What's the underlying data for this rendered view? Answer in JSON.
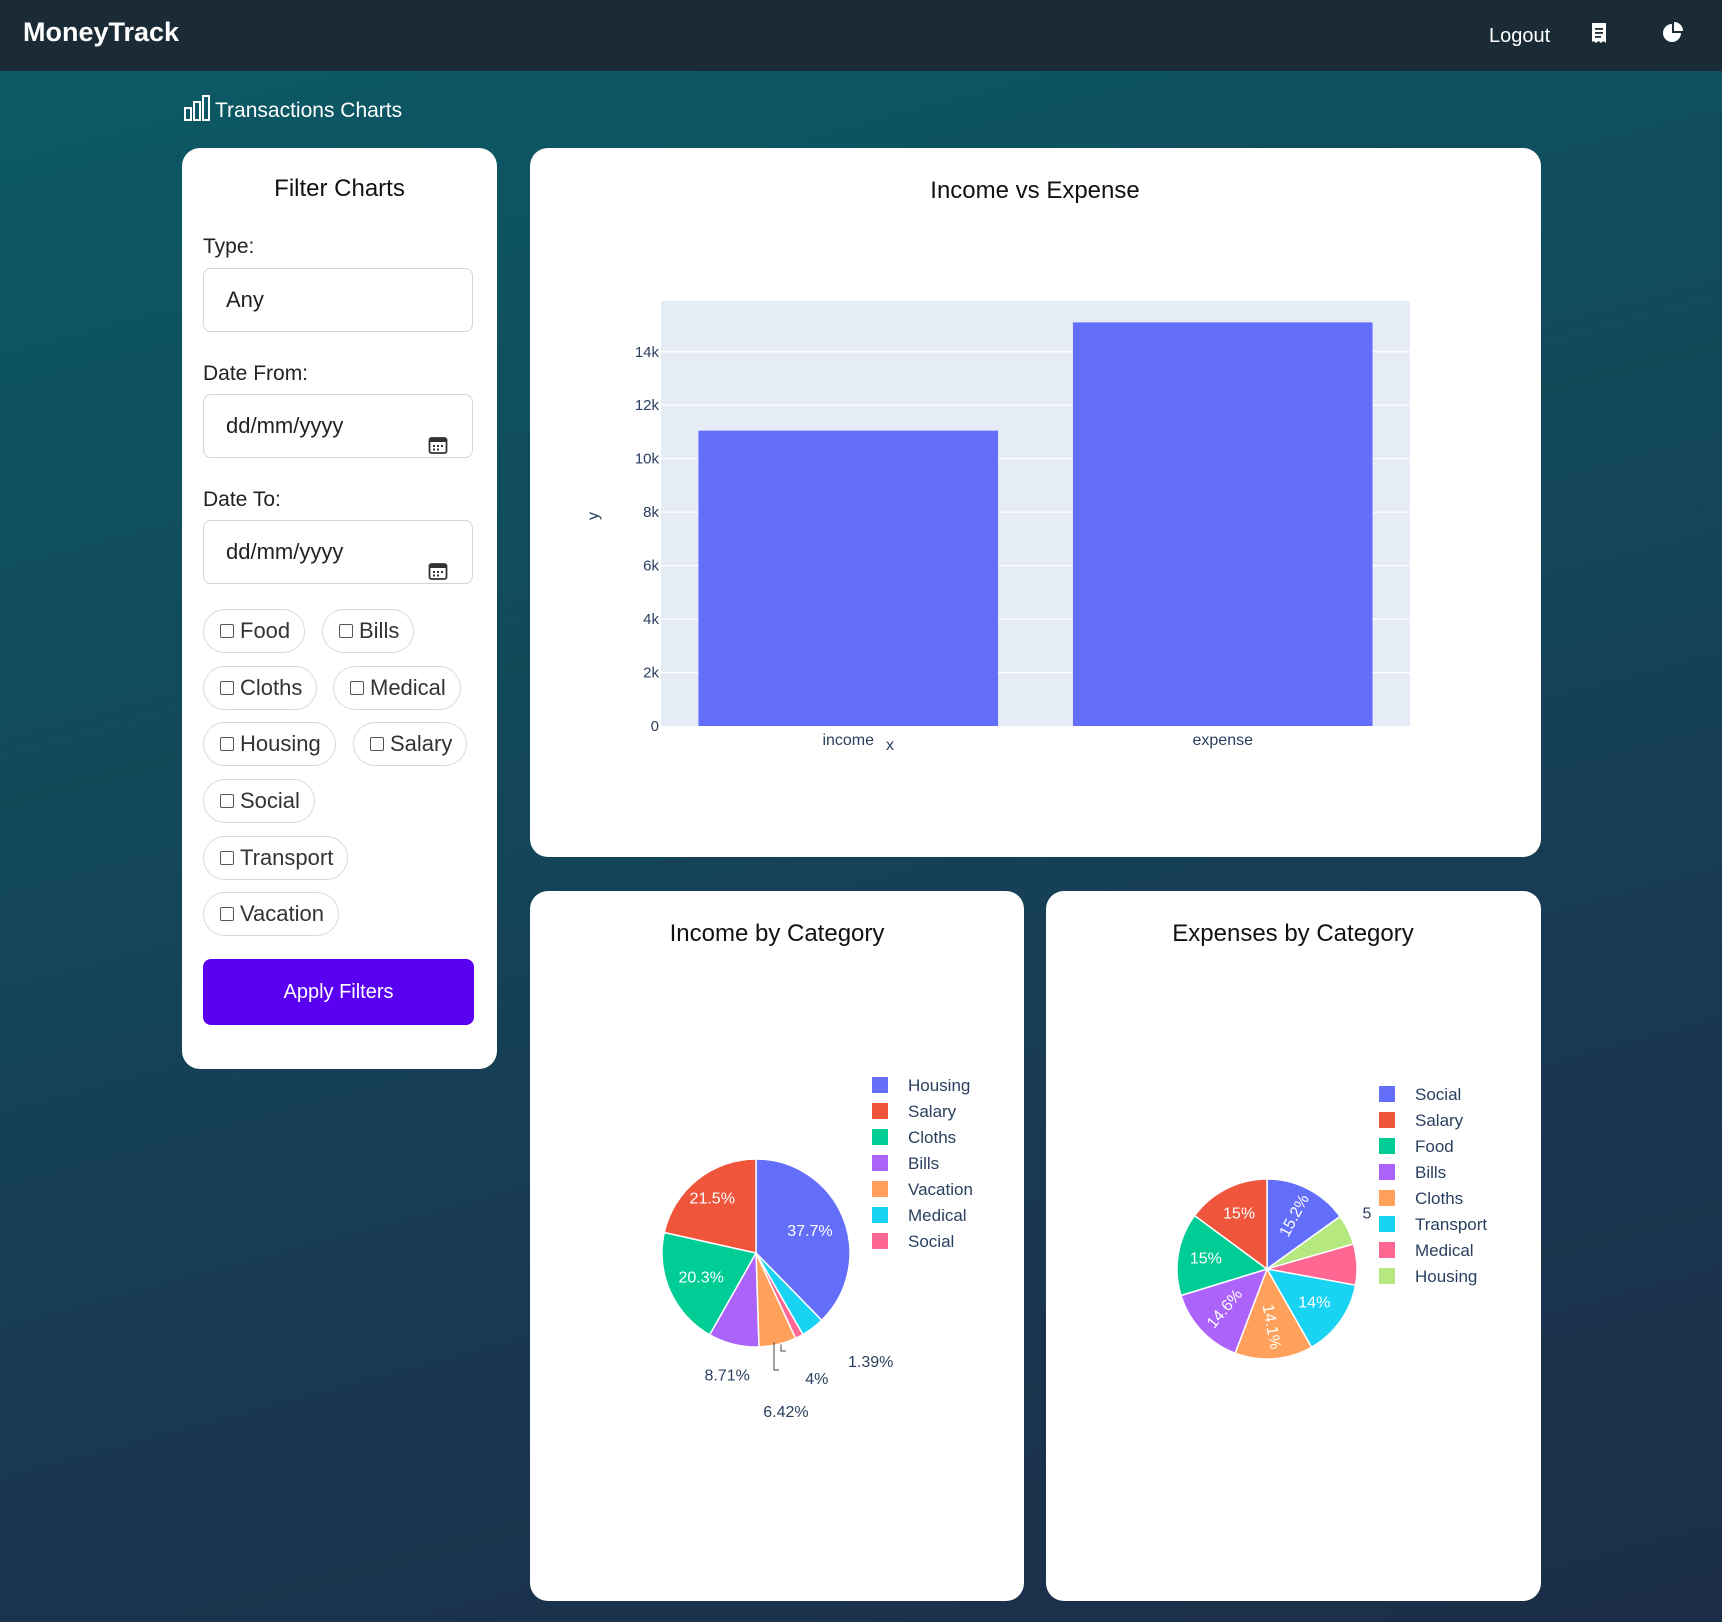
{
  "header": {
    "brand": "MoneyTrack",
    "logout_label": "Logout",
    "icons": [
      "receipt-icon",
      "pie-chart-icon"
    ]
  },
  "page": {
    "heading": "Transactions Charts",
    "heading_icon": "bar-chart-icon"
  },
  "filter": {
    "title": "Filter Charts",
    "type_label": "Type:",
    "type_value": "Any",
    "date_from_label": "Date From:",
    "date_from_placeholder": "dd/mm/yyyy",
    "date_to_label": "Date To:",
    "date_to_placeholder": "dd/mm/yyyy",
    "categories": [
      "Food",
      "Bills",
      "Cloths",
      "Medical",
      "Housing",
      "Salary",
      "Social",
      "Transport",
      "Vacation"
    ],
    "apply_label": "Apply Filters"
  },
  "colors": {
    "accent": "#5a00f2",
    "bar": "#636efa",
    "plot_bg": "#e5ecf6"
  },
  "chart_data": [
    {
      "type": "bar",
      "title": "Income vs Expense",
      "categories": [
        "income",
        "expense"
      ],
      "values": [
        11050,
        15100
      ],
      "xlabel": "x",
      "ylabel": "y",
      "ylim": [
        0,
        15900
      ],
      "yticks": [
        0,
        2000,
        4000,
        6000,
        8000,
        10000,
        12000,
        14000
      ],
      "ytick_labels": [
        "0",
        "2k",
        "4k",
        "6k",
        "8k",
        "10k",
        "12k",
        "14k"
      ],
      "grid": true
    },
    {
      "type": "pie",
      "title": "Income by Category",
      "legend_position": "right",
      "slices": [
        {
          "label": "Housing",
          "value": 37.7,
          "text": "37.7%",
          "color": "#636efa"
        },
        {
          "label": "Medical",
          "value": 4,
          "text": "4%",
          "color": "#19d3f3"
        },
        {
          "label": "Social",
          "value": 1.39,
          "text": "1.39%",
          "color": "#ff6692"
        },
        {
          "label": "Vacation",
          "value": 6.42,
          "text": "6.42%",
          "color": "#ffa15a"
        },
        {
          "label": "Bills",
          "value": 8.71,
          "text": "8.71%",
          "color": "#ab63fa"
        },
        {
          "label": "Cloths",
          "value": 20.3,
          "text": "20.3%",
          "color": "#00cc96"
        },
        {
          "label": "Salary",
          "value": 21.5,
          "text": "21.5%",
          "color": "#ef553b"
        }
      ],
      "legend_order": [
        "Housing",
        "Salary",
        "Cloths",
        "Bills",
        "Vacation",
        "Medical",
        "Social"
      ]
    },
    {
      "type": "pie",
      "title": "Expenses by Category",
      "legend_position": "right",
      "slices": [
        {
          "label": "Social",
          "value": 15.2,
          "text": "15.2%",
          "color": "#636efa"
        },
        {
          "label": "Housing",
          "value": 5.5,
          "text": "5",
          "color": "#b6e880"
        },
        {
          "label": "Medical",
          "value": 7.4,
          "text": "",
          "color": "#ff6692"
        },
        {
          "label": "Transport",
          "value": 14,
          "text": "14%",
          "color": "#19d3f3"
        },
        {
          "label": "Cloths",
          "value": 14.1,
          "text": "14.1%",
          "color": "#ffa15a"
        },
        {
          "label": "Bills",
          "value": 14.6,
          "text": "14.6%",
          "color": "#ab63fa"
        },
        {
          "label": "Food",
          "value": 15,
          "text": "15%",
          "color": "#00cc96"
        },
        {
          "label": "Salary",
          "value": 15,
          "text": "15%",
          "color": "#ef553b"
        }
      ],
      "legend_order": [
        "Social",
        "Salary",
        "Food",
        "Bills",
        "Cloths",
        "Transport",
        "Medical",
        "Housing"
      ]
    }
  ]
}
